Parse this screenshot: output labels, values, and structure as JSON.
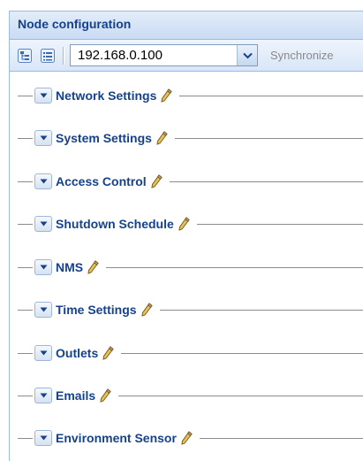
{
  "panel": {
    "title": "Node configuration"
  },
  "toolbar": {
    "expand_icon": "tree-expand-icon",
    "list_icon": "list-view-icon",
    "node_select": {
      "value": "192.168.0.100"
    },
    "synchronize_label": "Synchronize"
  },
  "sections": [
    {
      "label": "Network Settings"
    },
    {
      "label": "System Settings"
    },
    {
      "label": "Access Control"
    },
    {
      "label": "Shutdown Schedule"
    },
    {
      "label": "NMS"
    },
    {
      "label": "Time Settings"
    },
    {
      "label": "Outlets"
    },
    {
      "label": "Emails"
    },
    {
      "label": "Environment Sensor"
    }
  ],
  "colors": {
    "header_text": "#15428b",
    "border": "#99bbe8",
    "disabled_text": "#8a8a8a"
  }
}
